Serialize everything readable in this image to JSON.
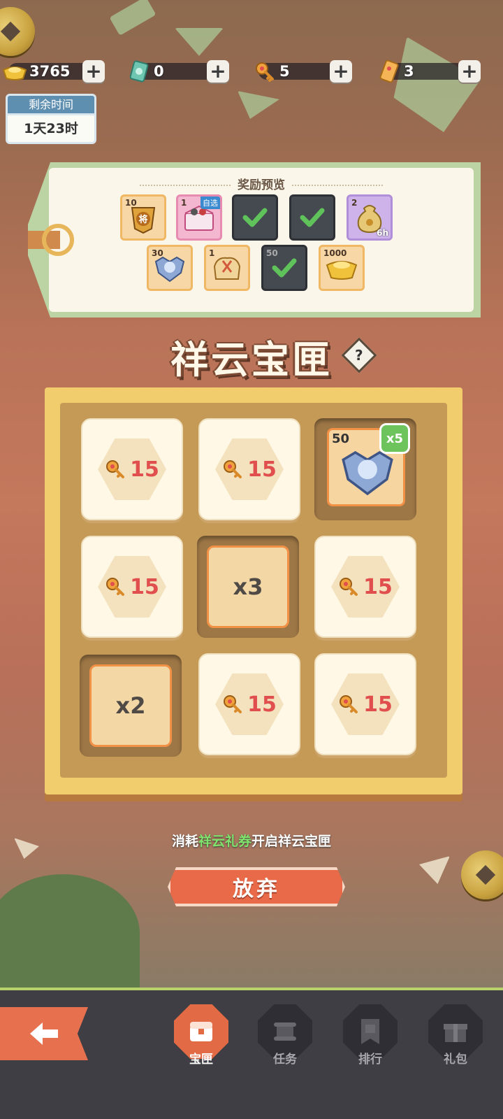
{
  "currencies": [
    {
      "icon": "gold-ingot-icon",
      "value": "3765"
    },
    {
      "icon": "ticket-card-icon",
      "value": "0"
    },
    {
      "icon": "key-icon",
      "value": "5"
    },
    {
      "icon": "voucher-icon",
      "value": "3"
    }
  ],
  "timer": {
    "label": "剩余时间",
    "value": "1天23时"
  },
  "preview": {
    "title": "奖励预览",
    "items": [
      {
        "icon": "general-token-icon",
        "qty": "10",
        "style": "gold",
        "claimed": false
      },
      {
        "icon": "select-gift-box-icon",
        "qty": "1",
        "tag": "自选",
        "style": "pink",
        "claimed": false
      },
      {
        "icon": "claimed-item-icon",
        "qty": "",
        "style": "done",
        "claimed": true
      },
      {
        "icon": "claimed-item-icon",
        "qty": "",
        "style": "done",
        "claimed": true
      },
      {
        "icon": "money-bag-icon",
        "qty": "2",
        "sub": "6h",
        "style": "purple",
        "claimed": false
      },
      {
        "icon": "blue-emblem-icon",
        "qty": "30",
        "style": "gold",
        "claimed": false
      },
      {
        "icon": "cloth-bundle-icon",
        "qty": "1",
        "style": "gold",
        "claimed": false
      },
      {
        "icon": "claimed-item-icon",
        "qty": "50",
        "style": "done",
        "claimed": true
      },
      {
        "icon": "gold-ingot-icon",
        "qty": "1000",
        "style": "gold",
        "claimed": false
      }
    ]
  },
  "main_title": "祥云宝匣",
  "help_label": "?",
  "board": {
    "cells": [
      {
        "type": "key",
        "value": "15"
      },
      {
        "type": "key",
        "value": "15"
      },
      {
        "type": "prize",
        "qty": "50",
        "badge": "x5"
      },
      {
        "type": "key",
        "value": "15"
      },
      {
        "type": "mult",
        "value": "x3"
      },
      {
        "type": "key",
        "value": "15"
      },
      {
        "type": "mult",
        "value": "x2"
      },
      {
        "type": "key",
        "value": "15"
      },
      {
        "type": "key",
        "value": "15"
      }
    ]
  },
  "hint": {
    "pre": "消耗",
    "highlight": "祥云礼券",
    "post": "开启祥云宝匣"
  },
  "abandon_label": "放弃",
  "nav": {
    "back_icon": "back-arrow-icon",
    "tabs": [
      {
        "label": "宝匣",
        "icon": "chest-icon",
        "active": true
      },
      {
        "label": "任务",
        "icon": "scroll-icon",
        "active": false
      },
      {
        "label": "排行",
        "icon": "banner-icon",
        "active": false
      },
      {
        "label": "礼包",
        "icon": "gift-icon",
        "active": false
      }
    ]
  },
  "colors": {
    "accent": "#e86a48",
    "highlight": "#7fe36c",
    "key_number": "#e04e4e"
  }
}
